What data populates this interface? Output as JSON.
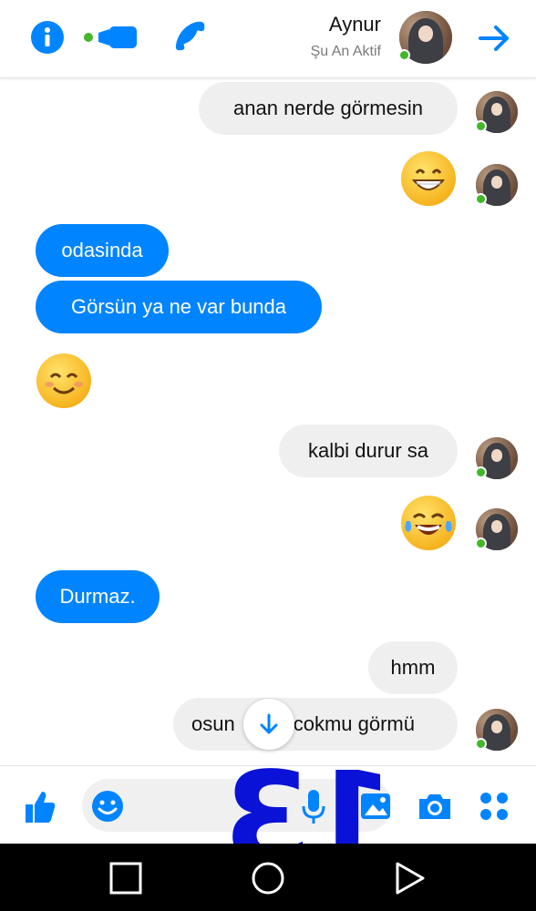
{
  "header": {
    "name": "Aynur",
    "status": "Şu An Aktif",
    "icons": [
      "info-icon",
      "video-call-icon",
      "phone-icon",
      "back-arrow-icon"
    ],
    "accent": "#0084ff",
    "online_color": "#42b72a"
  },
  "messages": [
    {
      "side": "incoming",
      "text": "anan nerde görmesin"
    },
    {
      "side": "incoming",
      "emoji": "grinning-face"
    },
    {
      "side": "outgoing",
      "text": "odasinda"
    },
    {
      "side": "outgoing",
      "text": "Görsün ya ne var bunda"
    },
    {
      "side": "outgoing",
      "emoji": "smiling-face"
    },
    {
      "side": "incoming",
      "text": "kalbi durur sa"
    },
    {
      "side": "incoming",
      "emoji": "tears-of-joy-face"
    },
    {
      "side": "outgoing",
      "text": "Durmaz."
    },
    {
      "side": "incoming",
      "text": "hmm"
    },
    {
      "side": "incoming",
      "text": "cokmu görmü",
      "text_tail": "osun"
    }
  ],
  "composer": {
    "icons": [
      "thumbs-up-icon",
      "emoji-icon",
      "microphone-icon",
      "gallery-icon",
      "camera-icon",
      "more-apps-icon"
    ]
  },
  "overlay": {
    "number": "13",
    "color": "#0a12d8"
  },
  "navbar": {
    "icons": [
      "recents-square-icon",
      "home-circle-icon",
      "back-triangle-icon"
    ]
  }
}
